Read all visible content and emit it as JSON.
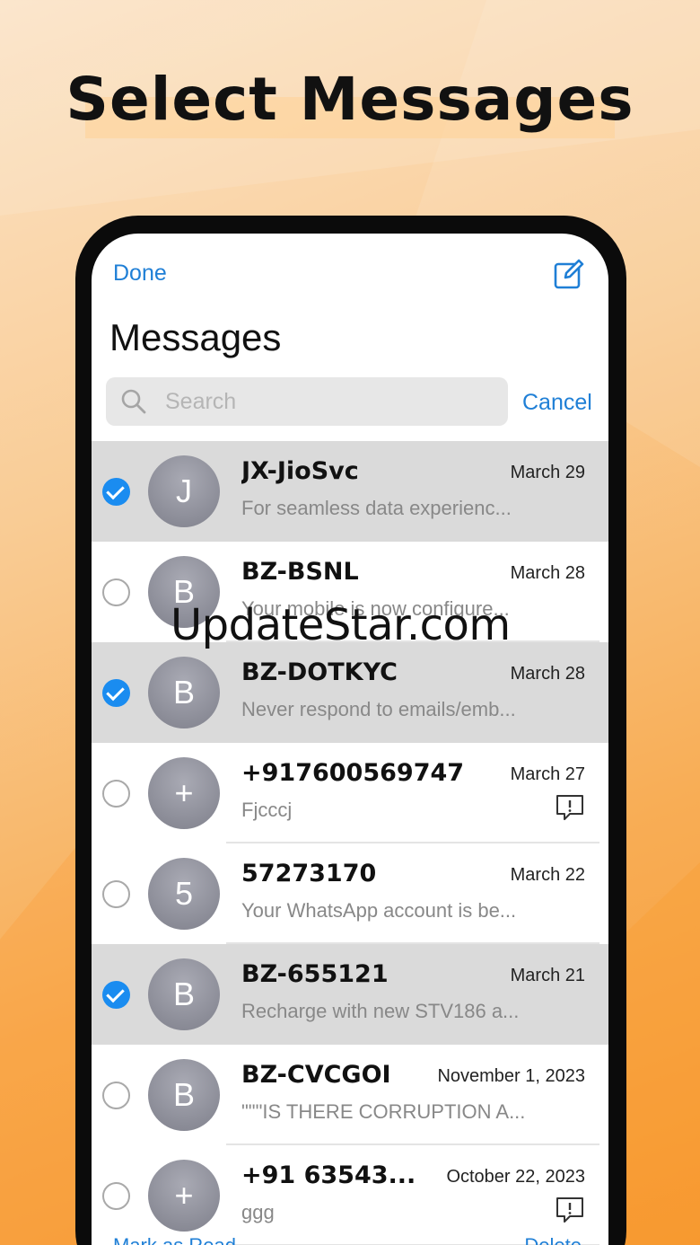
{
  "headline": "Select Messages",
  "header": {
    "done_label": "Done",
    "title": "Messages",
    "compose_icon": "compose-icon"
  },
  "search": {
    "placeholder": "Search",
    "cancel_label": "Cancel"
  },
  "conversations": [
    {
      "selected": true,
      "initial": "J",
      "sender": "JX-JioSvc",
      "date": "March 29",
      "preview": "For seamless data experienc...",
      "alert": false
    },
    {
      "selected": false,
      "initial": "B",
      "sender": "BZ-BSNL",
      "date": "March 28",
      "preview": "Your mobile is now configure...",
      "alert": false
    },
    {
      "selected": true,
      "initial": "B",
      "sender": "BZ-DOTKYC",
      "date": "March 28",
      "preview": "Never respond to emails/emb...",
      "alert": false
    },
    {
      "selected": false,
      "initial": "+",
      "sender": "+917600569747",
      "date": "March 27",
      "preview": "Fjcccj",
      "alert": true
    },
    {
      "selected": false,
      "initial": "5",
      "sender": "57273170",
      "date": "March 22",
      "preview": "Your WhatsApp account is be...",
      "alert": false
    },
    {
      "selected": true,
      "initial": "B",
      "sender": "BZ-655121",
      "date": "March 21",
      "preview": "Recharge with new STV186 a...",
      "alert": false
    },
    {
      "selected": false,
      "initial": "B",
      "sender": "BZ-CVCGOI",
      "date": "November 1, 2023",
      "preview": "\"\"\"IS THERE CORRUPTION A...",
      "alert": false
    },
    {
      "selected": false,
      "initial": "+",
      "sender": "+91 63543...",
      "date": "October 22, 2023",
      "preview": "ggg",
      "alert": true
    }
  ],
  "bottom_bar": {
    "mark_read_label": "Mark as Read",
    "delete_label": "Delete"
  },
  "watermark": "UpdateStar.com",
  "colors": {
    "accent": "#1f7fd6",
    "check_fill": "#1a8cf0",
    "selected_row": "#dadada",
    "avatar": "#8b8c97"
  }
}
